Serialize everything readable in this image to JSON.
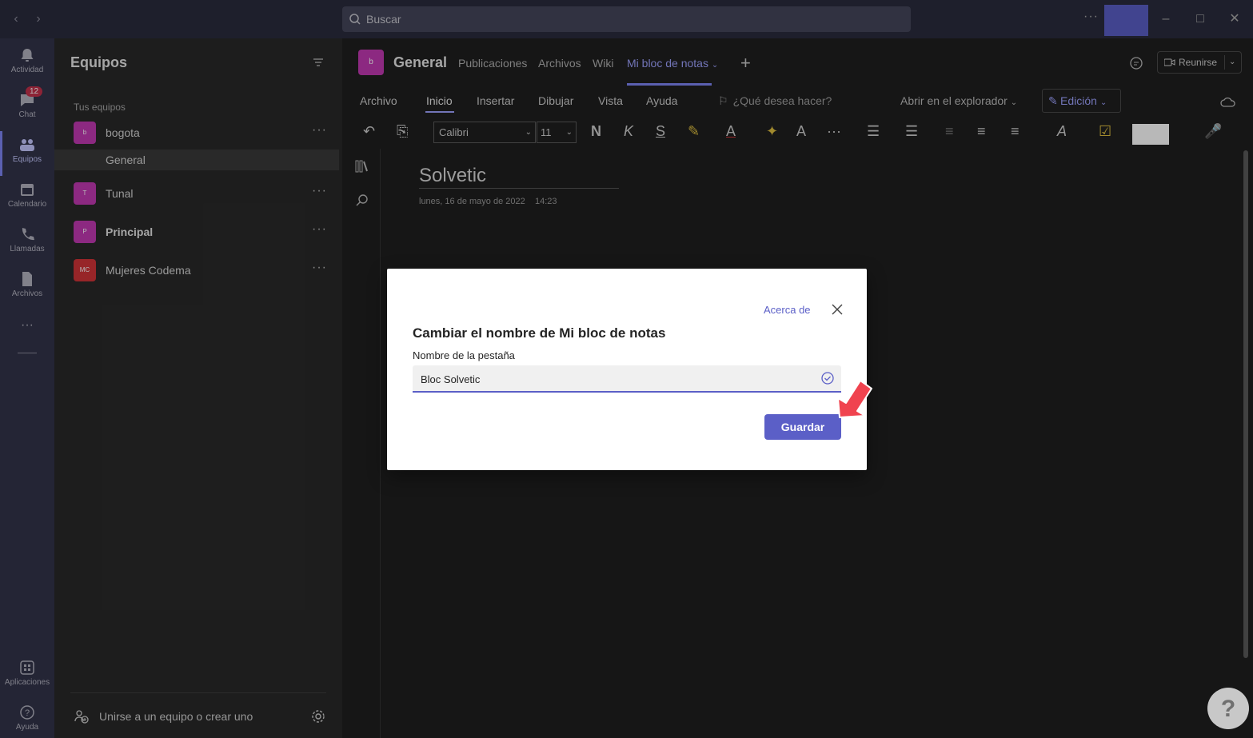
{
  "titlebar": {
    "search_placeholder": "Buscar",
    "more": "···"
  },
  "rail": {
    "items": [
      {
        "label": "Actividad",
        "icon": "bell-icon"
      },
      {
        "label": "Chat",
        "icon": "chat-icon",
        "badge": "12"
      },
      {
        "label": "Equipos",
        "icon": "teams-icon",
        "active": true
      },
      {
        "label": "Calendario",
        "icon": "calendar-icon"
      },
      {
        "label": "Llamadas",
        "icon": "phone-icon"
      },
      {
        "label": "Archivos",
        "icon": "file-icon"
      }
    ],
    "more": "···",
    "bottom": [
      {
        "label": "Aplicaciones",
        "icon": "apps-icon"
      },
      {
        "label": "Ayuda",
        "icon": "help-icon"
      }
    ]
  },
  "teams_panel": {
    "title": "Equipos",
    "section_label": "Tus equipos",
    "teams": [
      {
        "initial": "b",
        "name": "bogota",
        "color": "#c239b3"
      },
      {
        "initial": "T",
        "name": "Tunal",
        "color": "#c239b3"
      },
      {
        "initial": "P",
        "name": "Principal",
        "color": "#c239b3",
        "bold": true
      },
      {
        "initial": "MC",
        "name": "Mujeres Codema",
        "color": "#d13438"
      }
    ],
    "channel": "General",
    "join": "Unirse a un equipo o crear uno"
  },
  "channel_header": {
    "avatar_initial": "b",
    "title": "General",
    "tabs": [
      "Publicaciones",
      "Archivos",
      "Wiki",
      "Mi bloc de notas"
    ],
    "active_tab": "Mi bloc de notas",
    "meet_label": "Reunirse"
  },
  "ribbon": {
    "tabs": [
      "Archivo",
      "Inicio",
      "Insertar",
      "Dibujar",
      "Vista",
      "Ayuda"
    ],
    "active_tab": "Inicio",
    "tell_me": "¿Qué desea hacer?",
    "open_browser": "Abrir en el explorador",
    "edit_mode": "Edición",
    "font": "Calibri",
    "size": "11",
    "bold": "N",
    "italic": "K",
    "strike": "S"
  },
  "page": {
    "title": "Solvetic",
    "date": "lunes, 16 de mayo de 2022",
    "time": "14:23"
  },
  "dialog": {
    "about_link": "Acerca de",
    "title": "Cambiar el nombre de Mi bloc de notas",
    "field_label": "Nombre de la pestaña",
    "field_value": "Bloc Solvetic",
    "save_label": "Guardar"
  },
  "colors": {
    "accent": "#5b5fc7",
    "rail_bg": "#33344a",
    "titlebar_bg": "#2a2b3d",
    "arrow": "#f0434f"
  }
}
